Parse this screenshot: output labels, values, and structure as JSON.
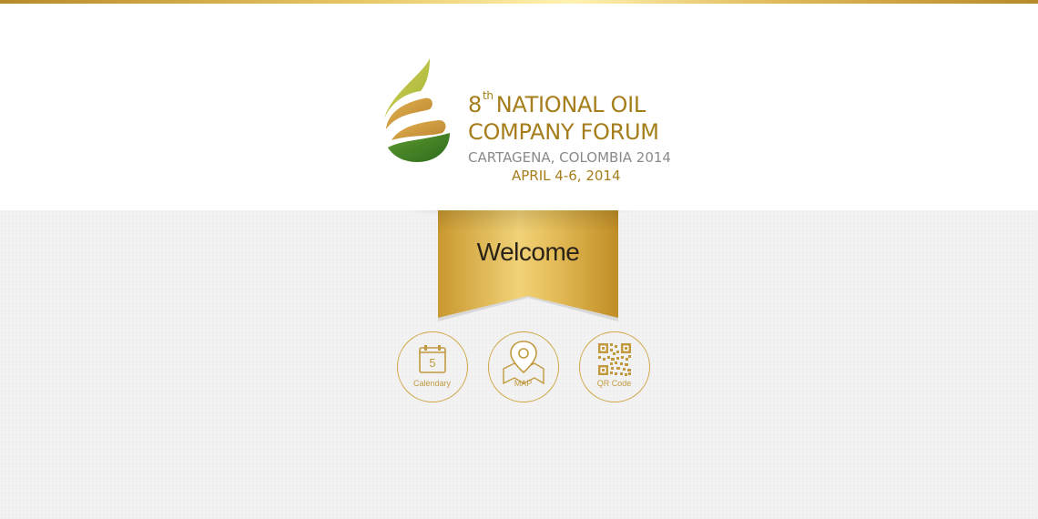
{
  "header": {
    "logo": {
      "line1_number": "8",
      "line1_super": "th",
      "line1_rest": "NATIONAL OIL",
      "line2": "COMPANY FORUM",
      "line3": "CARTAGENA, COLOMBIA 2014",
      "line4": "APRIL 4-6,  2014"
    }
  },
  "ribbon": {
    "label": "Welcome"
  },
  "nav": {
    "items": [
      {
        "label": "Calendary",
        "icon": "calendar-icon",
        "day": "5"
      },
      {
        "label": "MAP",
        "icon": "map-pin-icon"
      },
      {
        "label": "QR Code",
        "icon": "qr-code-icon"
      }
    ]
  },
  "colors": {
    "gold": "#a57d1b",
    "gold_light": "#cfa645",
    "gray_text": "#8a8a8a",
    "background": "#f2f2f2"
  }
}
